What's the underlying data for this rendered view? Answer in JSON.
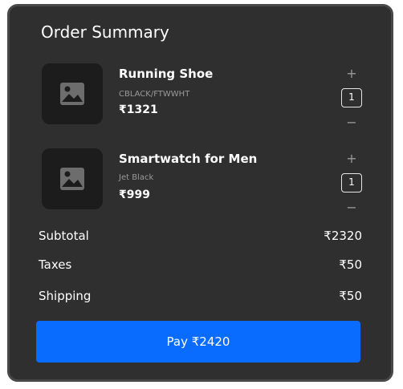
{
  "title": "Order Summary",
  "currency_symbol": "₹",
  "items": [
    {
      "name": "Running Shoe",
      "variant": "CBLACK/FTWWHT",
      "price": "₹1321",
      "quantity": "1",
      "plus": "+",
      "minus": "−",
      "image_icon": "image-placeholder-icon"
    },
    {
      "name": "Smartwatch for Men",
      "variant": "Jet Black",
      "price": "₹999",
      "quantity": "1",
      "plus": "+",
      "minus": "−",
      "image_icon": "image-placeholder-icon"
    }
  ],
  "summary": {
    "subtotal_label": "Subtotal",
    "subtotal_value": "₹2320",
    "taxes_label": "Taxes",
    "taxes_value": "₹50",
    "shipping_label": "Shipping",
    "shipping_value": "₹50"
  },
  "pay_button": "Pay ₹2420",
  "colors": {
    "card_background": "#2f2f2f",
    "card_border": "#484848",
    "thumbnail_background": "#1c1c1c",
    "accent": "#0a6cff",
    "muted_text": "#9a9a9a"
  }
}
